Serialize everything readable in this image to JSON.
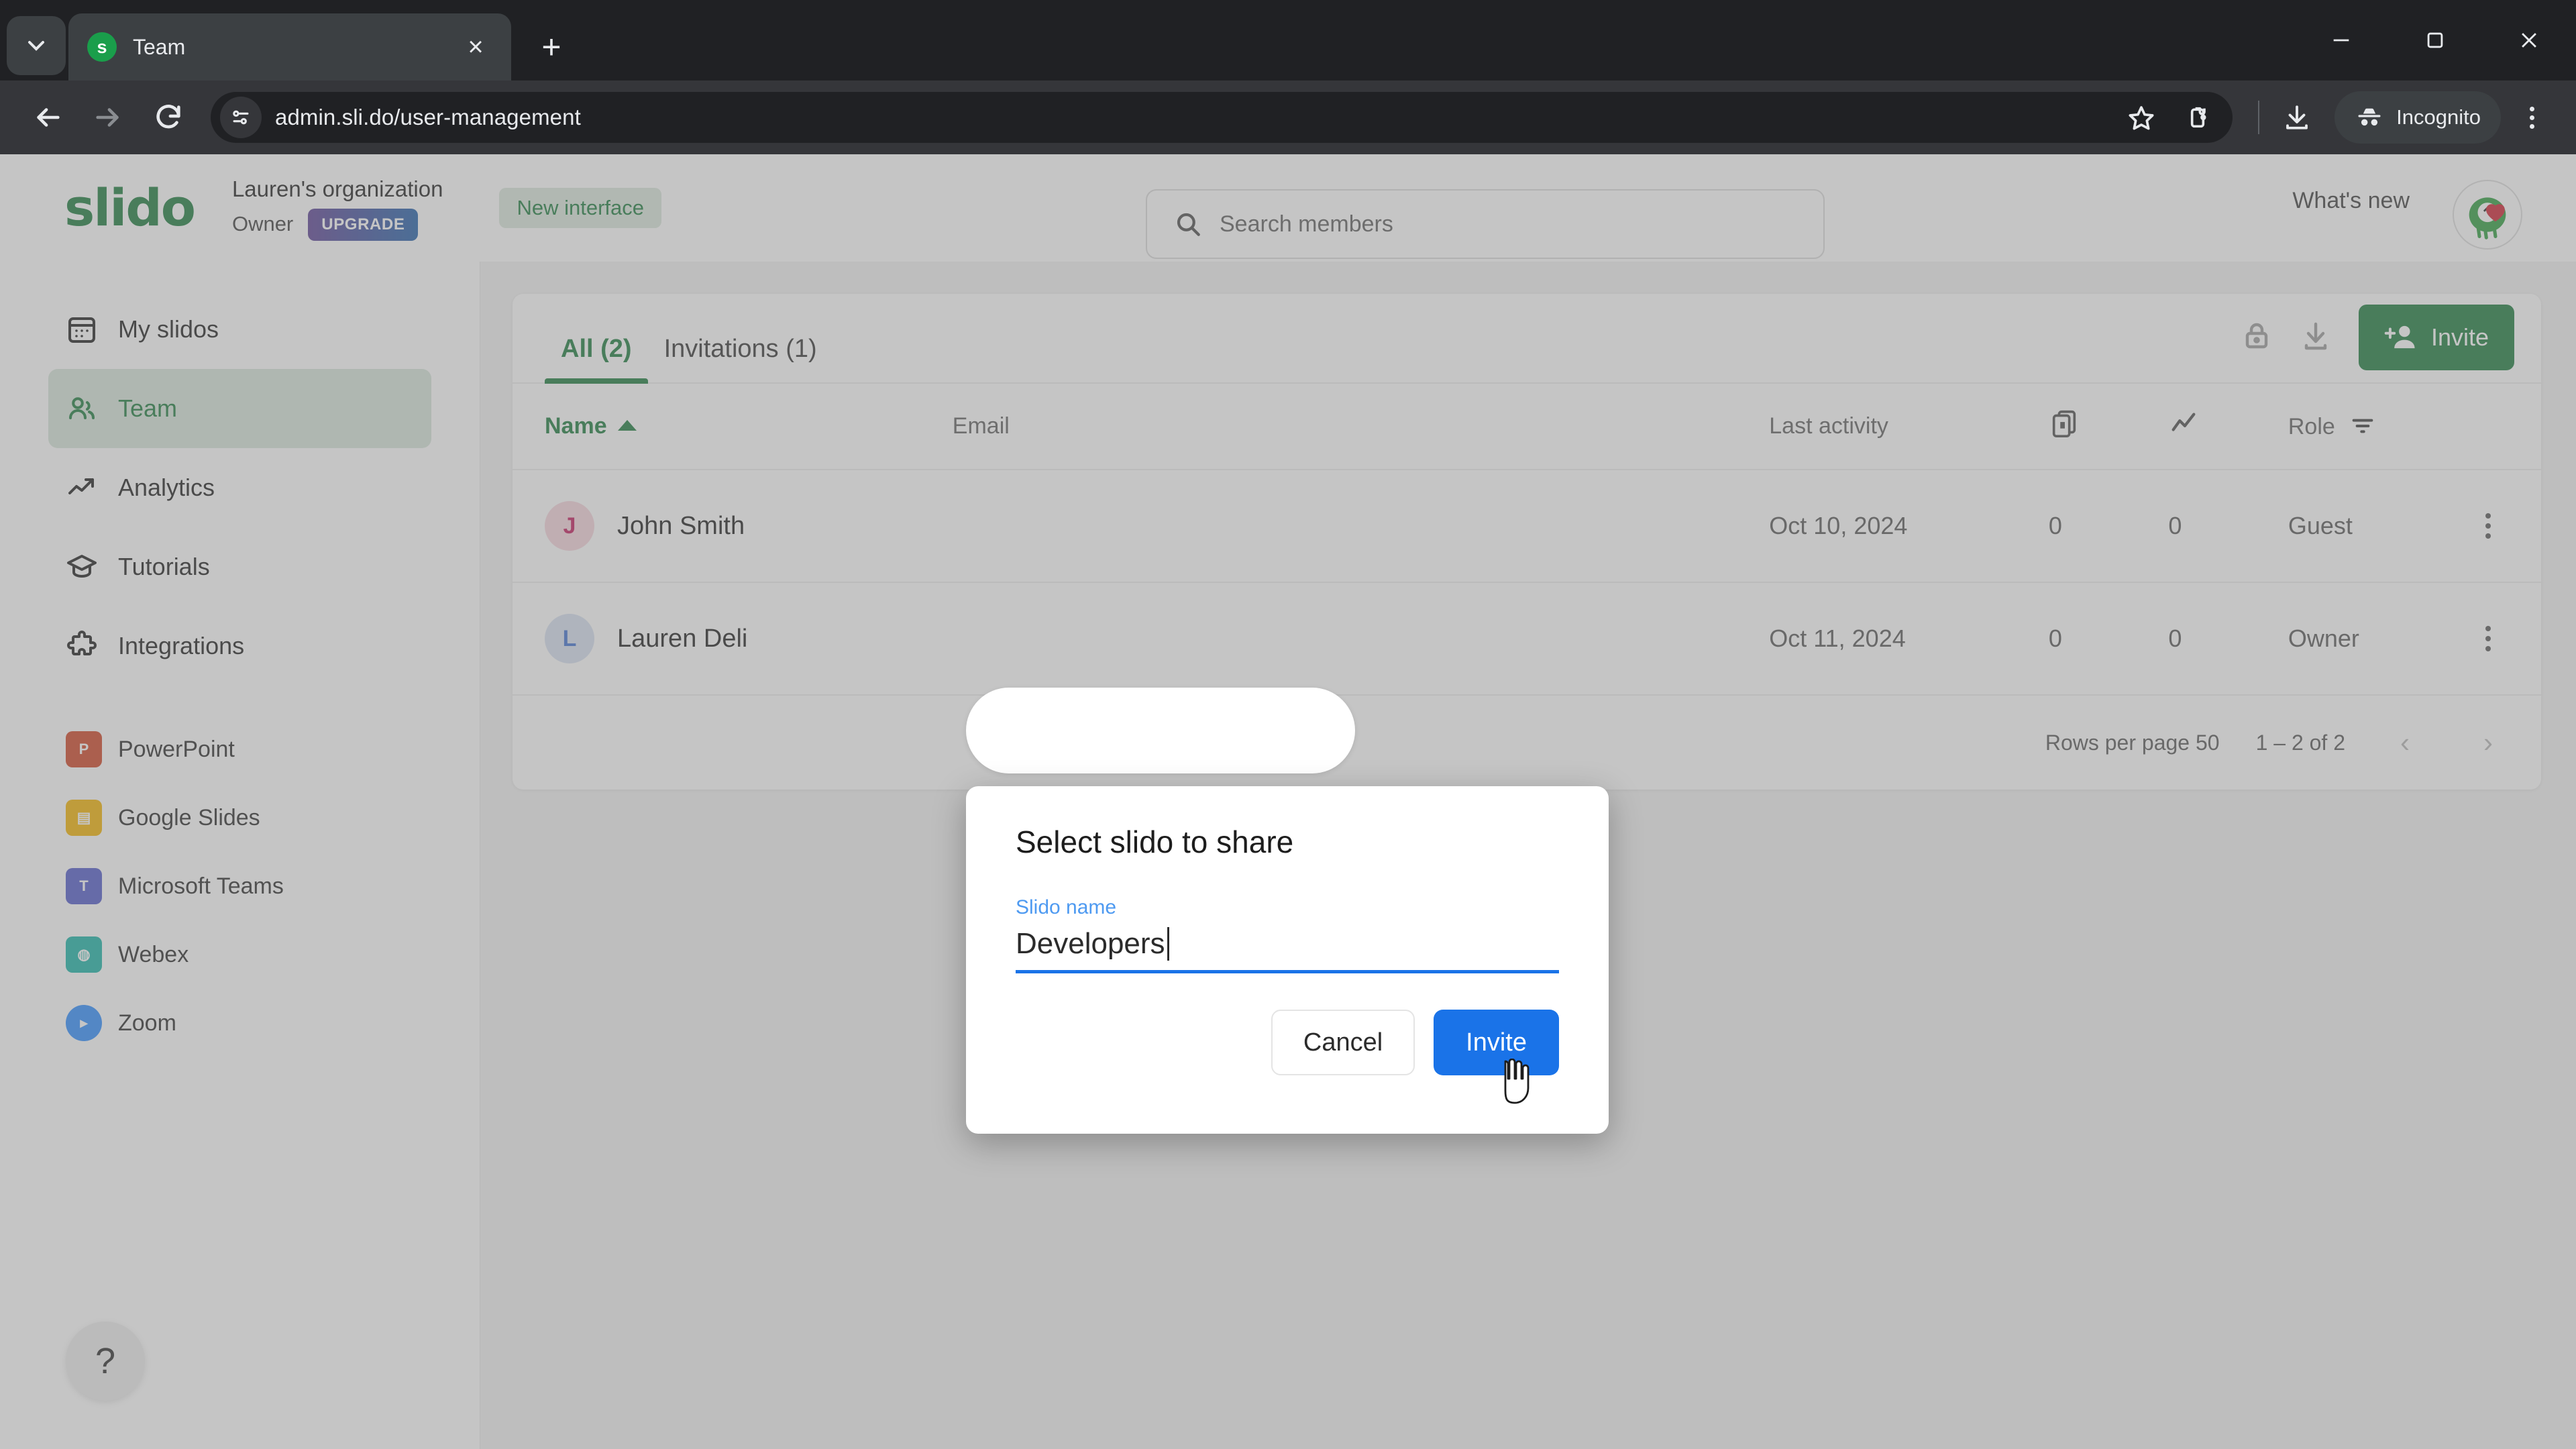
{
  "browser": {
    "tab": {
      "title": "Team",
      "favicon_letter": "s",
      "close_label": "×"
    },
    "new_tab_label": "+",
    "url": "admin.sli.do/user-management",
    "profile_label": "Incognito",
    "icons": {
      "tab_search": "chevron-down-icon",
      "back": "back-arrow-icon",
      "forward": "forward-arrow-icon",
      "reload": "reload-icon",
      "site_info": "site-settings-icon",
      "bookmark": "star-icon",
      "extensions": "extensions-icon",
      "downloads": "download-icon",
      "incognito": "incognito-icon",
      "menu": "kebab-menu-icon",
      "minimize": "minimize-icon",
      "maximize": "maximize-icon",
      "close": "close-window-icon"
    }
  },
  "app": {
    "logo_text": "slido",
    "org_name": "Lauren's organization",
    "org_role": "Owner",
    "upgrade_label": "UPGRADE",
    "new_interface_label": "New interface",
    "whats_new_label": "What's new",
    "search": {
      "placeholder": "Search members"
    },
    "help_label": "?"
  },
  "sidebar": {
    "nav": [
      {
        "label": "My slidos",
        "icon": "calendar-grid-icon",
        "active": false
      },
      {
        "label": "Team",
        "icon": "people-icon",
        "active": true
      },
      {
        "label": "Analytics",
        "icon": "trend-up-icon",
        "active": false
      },
      {
        "label": "Tutorials",
        "icon": "graduation-cap-icon",
        "active": false
      },
      {
        "label": "Integrations",
        "icon": "puzzle-piece-icon",
        "active": false
      }
    ],
    "integrations": [
      {
        "label": "PowerPoint",
        "icon": "powerpoint-icon",
        "color": "#d04423"
      },
      {
        "label": "Google Slides",
        "icon": "google-slides-icon",
        "color": "#f4b400"
      },
      {
        "label": "Microsoft Teams",
        "icon": "microsoft-teams-icon",
        "color": "#5059c9"
      },
      {
        "label": "Webex",
        "icon": "webex-icon",
        "color": "#19b3a6"
      },
      {
        "label": "Zoom",
        "icon": "zoom-icon",
        "color": "#2d8cff"
      }
    ]
  },
  "main": {
    "tabs": [
      {
        "label": "All (2)",
        "active": true
      },
      {
        "label": "Invitations (1)",
        "active": false
      }
    ],
    "toolbar": {
      "lock_icon": "lock-icon",
      "export_icon": "download-icon",
      "invite_label": "Invite"
    },
    "table": {
      "columns": [
        "Name",
        "Email",
        "Last activity",
        "",
        "",
        "Role",
        ""
      ],
      "col_icons": {
        "slidos": "slido-count-icon",
        "activity": "trend-up-icon",
        "role_filter": "filter-icon"
      },
      "rows": [
        {
          "initial": "J",
          "name": "John Smith",
          "email": "",
          "last_activity": "Oct 10, 2024",
          "slidos": "0",
          "participants": "0",
          "role": "Guest"
        },
        {
          "initial": "L",
          "name": "Lauren Deli",
          "email": "",
          "last_activity": "Oct 11, 2024",
          "slidos": "0",
          "participants": "0",
          "role": "Owner"
        }
      ]
    },
    "pagination": {
      "rows_per_page_label": "Rows per page 50",
      "range_label": "1 – 2 of 2",
      "prev": "‹",
      "next": "›"
    }
  },
  "modal": {
    "title": "Select slido to share",
    "field_label": "Slido name",
    "field_value": "Developers",
    "cancel_label": "Cancel",
    "confirm_label": "Invite"
  },
  "colors": {
    "brand_green": "#1a7a3c",
    "accent_blue": "#1a73e8",
    "label_blue": "#4e9af1",
    "chrome_dark": "#202124"
  }
}
